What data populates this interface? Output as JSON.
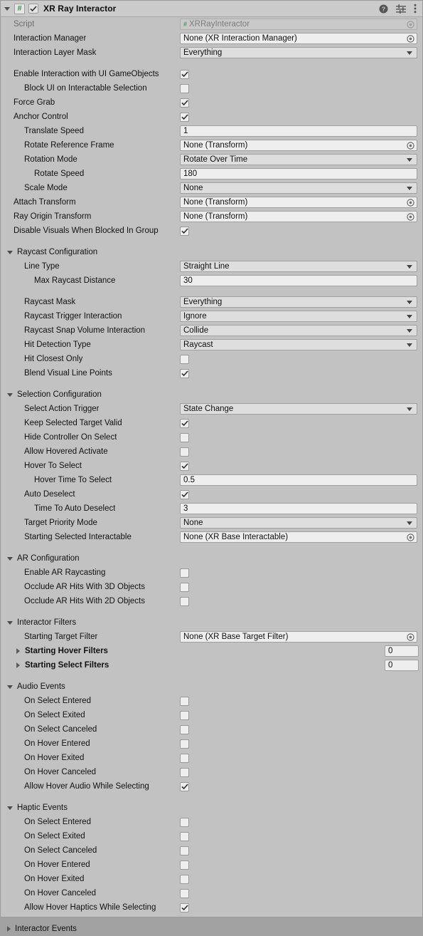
{
  "header": {
    "title": "XR Ray Interactor",
    "script_badge": "#",
    "enabled": true,
    "icons": [
      "help-icon",
      "preset-icon",
      "more-menu-icon"
    ]
  },
  "rows": [
    {
      "kind": "field",
      "indent": 0,
      "label": "Script",
      "dim": true,
      "control": "object",
      "value": "XRRayInteractor",
      "badge": "#",
      "disabled": true
    },
    {
      "kind": "field",
      "indent": 0,
      "label": "Interaction Manager",
      "control": "object",
      "value": "None (XR Interaction Manager)"
    },
    {
      "kind": "field",
      "indent": 0,
      "label": "Interaction Layer Mask",
      "control": "popup",
      "value": "Everything"
    },
    {
      "kind": "spacer"
    },
    {
      "kind": "field",
      "indent": 0,
      "label": "Enable Interaction with UI GameObjects",
      "control": "checkbox",
      "checked": true
    },
    {
      "kind": "field",
      "indent": 1,
      "label": "Block UI on Interactable Selection",
      "control": "checkbox",
      "checked": false
    },
    {
      "kind": "field",
      "indent": 0,
      "label": "Force Grab",
      "control": "checkbox",
      "checked": true
    },
    {
      "kind": "field",
      "indent": 0,
      "label": "Anchor Control",
      "control": "checkbox",
      "checked": true
    },
    {
      "kind": "field",
      "indent": 1,
      "label": "Translate Speed",
      "control": "text",
      "value": "1"
    },
    {
      "kind": "field",
      "indent": 1,
      "label": "Rotate Reference Frame",
      "control": "object",
      "value": "None (Transform)"
    },
    {
      "kind": "field",
      "indent": 1,
      "label": "Rotation Mode",
      "control": "popup",
      "value": "Rotate Over Time"
    },
    {
      "kind": "field",
      "indent": 2,
      "label": "Rotate Speed",
      "control": "text",
      "value": "180"
    },
    {
      "kind": "field",
      "indent": 1,
      "label": "Scale Mode",
      "control": "popup",
      "value": "None"
    },
    {
      "kind": "field",
      "indent": 0,
      "label": "Attach Transform",
      "control": "object",
      "value": "None (Transform)"
    },
    {
      "kind": "field",
      "indent": 0,
      "label": "Ray Origin Transform",
      "control": "object",
      "value": "None (Transform)"
    },
    {
      "kind": "field",
      "indent": 0,
      "label": "Disable Visuals When Blocked In Group",
      "control": "checkbox",
      "checked": true
    },
    {
      "kind": "spacer"
    },
    {
      "kind": "section",
      "label": "Raycast Configuration",
      "expanded": true
    },
    {
      "kind": "field",
      "indent": 1,
      "label": "Line Type",
      "control": "popup",
      "value": "Straight Line"
    },
    {
      "kind": "field",
      "indent": 2,
      "label": "Max Raycast Distance",
      "control": "text",
      "value": "30"
    },
    {
      "kind": "spacer"
    },
    {
      "kind": "field",
      "indent": 1,
      "label": "Raycast Mask",
      "control": "popup",
      "value": "Everything"
    },
    {
      "kind": "field",
      "indent": 1,
      "label": "Raycast Trigger Interaction",
      "control": "popup",
      "value": "Ignore"
    },
    {
      "kind": "field",
      "indent": 1,
      "label": "Raycast Snap Volume Interaction",
      "control": "popup",
      "value": "Collide"
    },
    {
      "kind": "field",
      "indent": 1,
      "label": "Hit Detection Type",
      "control": "popup",
      "value": "Raycast"
    },
    {
      "kind": "field",
      "indent": 1,
      "label": "Hit Closest Only",
      "control": "checkbox",
      "checked": false
    },
    {
      "kind": "field",
      "indent": 1,
      "label": "Blend Visual Line Points",
      "control": "checkbox",
      "checked": true
    },
    {
      "kind": "spacer"
    },
    {
      "kind": "section",
      "label": "Selection Configuration",
      "expanded": true
    },
    {
      "kind": "field",
      "indent": 1,
      "label": "Select Action Trigger",
      "control": "popup",
      "value": "State Change"
    },
    {
      "kind": "field",
      "indent": 1,
      "label": "Keep Selected Target Valid",
      "control": "checkbox",
      "checked": true
    },
    {
      "kind": "field",
      "indent": 1,
      "label": "Hide Controller On Select",
      "control": "checkbox",
      "checked": false
    },
    {
      "kind": "field",
      "indent": 1,
      "label": "Allow Hovered Activate",
      "control": "checkbox",
      "checked": false
    },
    {
      "kind": "field",
      "indent": 1,
      "label": "Hover To Select",
      "control": "checkbox",
      "checked": true
    },
    {
      "kind": "field",
      "indent": 2,
      "label": "Hover Time To Select",
      "control": "text",
      "value": "0.5"
    },
    {
      "kind": "field",
      "indent": 1,
      "label": "Auto Deselect",
      "control": "checkbox",
      "checked": true
    },
    {
      "kind": "field",
      "indent": 2,
      "label": "Time To Auto Deselect",
      "control": "text",
      "value": "3"
    },
    {
      "kind": "field",
      "indent": 1,
      "label": "Target Priority Mode",
      "control": "popup",
      "value": "None"
    },
    {
      "kind": "field",
      "indent": 1,
      "label": "Starting Selected Interactable",
      "control": "object",
      "value": "None (XR Base Interactable)"
    },
    {
      "kind": "spacer"
    },
    {
      "kind": "section",
      "label": "AR Configuration",
      "expanded": true
    },
    {
      "kind": "field",
      "indent": 1,
      "label": "Enable AR Raycasting",
      "control": "checkbox",
      "checked": false
    },
    {
      "kind": "field",
      "indent": 1,
      "label": "Occlude AR Hits With 3D Objects",
      "control": "checkbox",
      "checked": false
    },
    {
      "kind": "field",
      "indent": 1,
      "label": "Occlude AR Hits With 2D Objects",
      "control": "checkbox",
      "checked": false
    },
    {
      "kind": "spacer"
    },
    {
      "kind": "section",
      "label": "Interactor Filters",
      "expanded": true
    },
    {
      "kind": "field",
      "indent": 1,
      "label": "Starting Target Filter",
      "control": "object",
      "value": "None (XR Base Target Filter)"
    },
    {
      "kind": "foldout",
      "label": "Starting Hover Filters",
      "expanded": false,
      "count": "0"
    },
    {
      "kind": "foldout",
      "label": "Starting Select Filters",
      "expanded": false,
      "count": "0"
    },
    {
      "kind": "spacer"
    },
    {
      "kind": "section",
      "label": "Audio Events",
      "expanded": true
    },
    {
      "kind": "field",
      "indent": 1,
      "label": "On Select Entered",
      "control": "checkbox",
      "checked": false
    },
    {
      "kind": "field",
      "indent": 1,
      "label": "On Select Exited",
      "control": "checkbox",
      "checked": false
    },
    {
      "kind": "field",
      "indent": 1,
      "label": "On Select Canceled",
      "control": "checkbox",
      "checked": false
    },
    {
      "kind": "field",
      "indent": 1,
      "label": "On Hover Entered",
      "control": "checkbox",
      "checked": false
    },
    {
      "kind": "field",
      "indent": 1,
      "label": "On Hover Exited",
      "control": "checkbox",
      "checked": false
    },
    {
      "kind": "field",
      "indent": 1,
      "label": "On Hover Canceled",
      "control": "checkbox",
      "checked": false
    },
    {
      "kind": "field",
      "indent": 1,
      "label": "Allow Hover Audio While Selecting",
      "control": "checkbox",
      "checked": true
    },
    {
      "kind": "spacer"
    },
    {
      "kind": "section",
      "label": "Haptic Events",
      "expanded": true
    },
    {
      "kind": "field",
      "indent": 1,
      "label": "On Select Entered",
      "control": "checkbox",
      "checked": false
    },
    {
      "kind": "field",
      "indent": 1,
      "label": "On Select Exited",
      "control": "checkbox",
      "checked": false
    },
    {
      "kind": "field",
      "indent": 1,
      "label": "On Select Canceled",
      "control": "checkbox",
      "checked": false
    },
    {
      "kind": "field",
      "indent": 1,
      "label": "On Hover Entered",
      "control": "checkbox",
      "checked": false
    },
    {
      "kind": "field",
      "indent": 1,
      "label": "On Hover Exited",
      "control": "checkbox",
      "checked": false
    },
    {
      "kind": "field",
      "indent": 1,
      "label": "On Hover Canceled",
      "control": "checkbox",
      "checked": false
    },
    {
      "kind": "field",
      "indent": 1,
      "label": "Allow Hover Haptics While Selecting",
      "control": "checkbox",
      "checked": true
    },
    {
      "kind": "spacer"
    },
    {
      "kind": "section",
      "label": "Interactor Events",
      "expanded": false
    }
  ],
  "colors": {
    "panel_bg": "#c2c2c2",
    "header_bg": "#cbcbcb",
    "field_bg": "#eeeeee",
    "popup_bg": "#dedede",
    "disabled_text": "#6d6d6d",
    "script_green": "#3f8f4f"
  }
}
